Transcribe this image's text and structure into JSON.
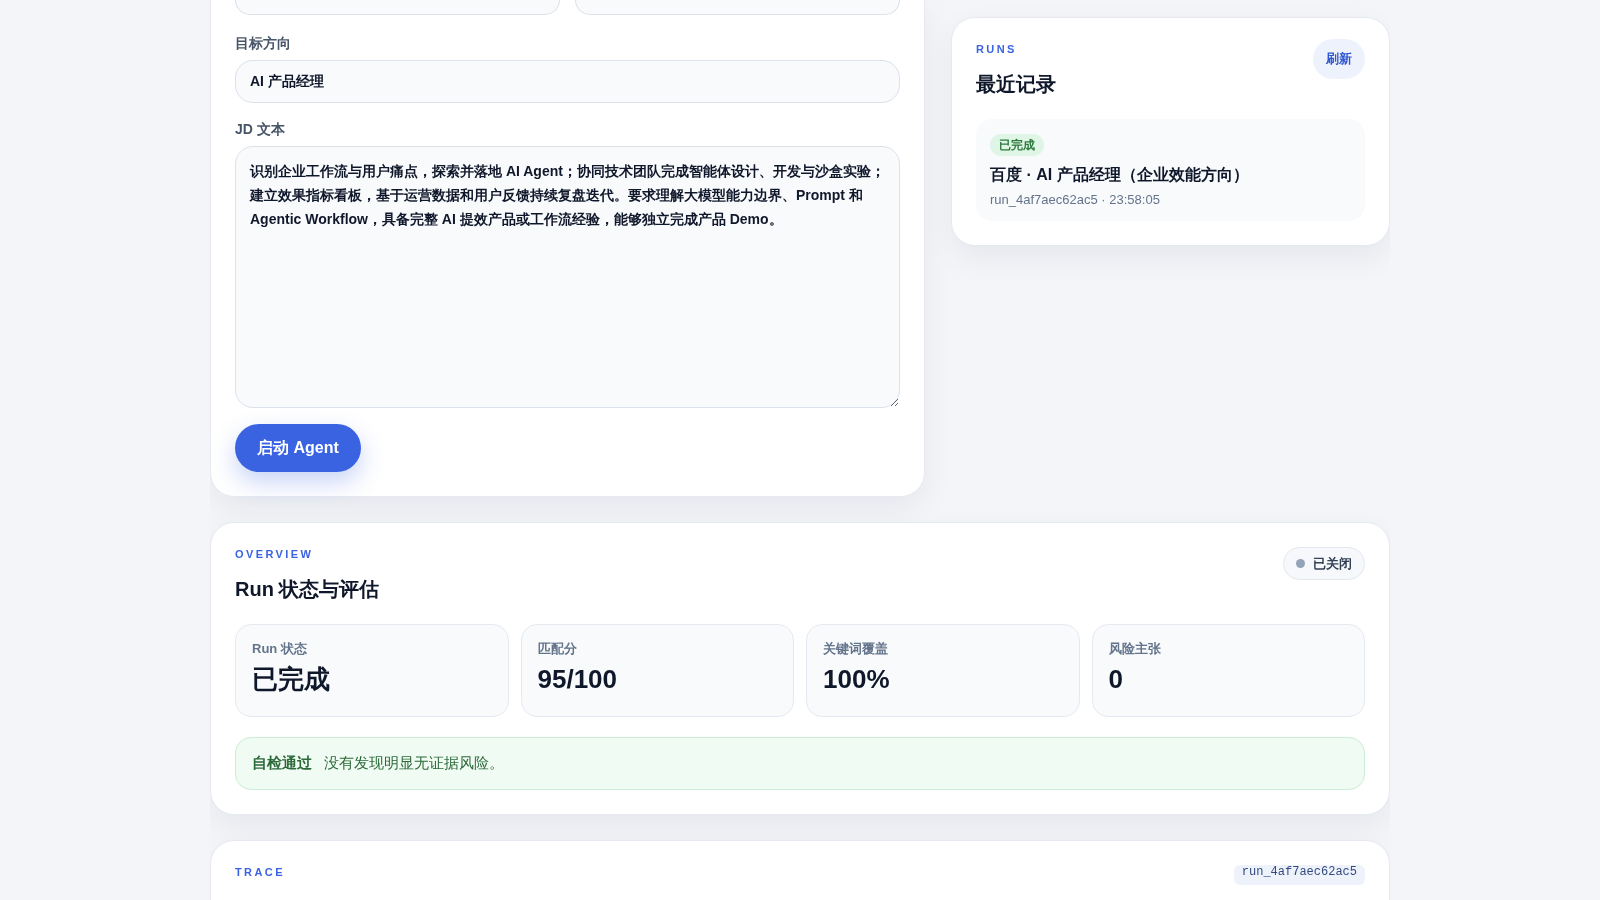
{
  "form": {
    "top_fields": [
      {
        "kind": "input"
      },
      {
        "kind": "input"
      }
    ],
    "fields": [
      {
        "label": "目标方向",
        "kind": "input",
        "value": "AI 产品经理"
      },
      {
        "label": "JD 文本",
        "kind": "textarea",
        "value": "识别企业工作流与用户痛点，探索并落地 AI Agent；协同技术团队完成智能体设计、开发与沙盒实验；建立效果指标看板，基于运营数据和用户反馈持续复盘迭代。要求理解大模型能力边界、Prompt 和 Agentic Workflow，具备完整 AI 提效产品或工作流经验，能够独立完成产品 Demo。"
      }
    ],
    "submit_button": "启动 Agent"
  },
  "runs": {
    "eyebrow": "RUNS",
    "title": "最近记录",
    "refresh_button": "刷新",
    "items": [
      {
        "status": "已完成",
        "completed": true,
        "title": "百度 · AI 产品经理（企业效能方向）",
        "meta": "run_4af7aec62ac5 · 23:58:05"
      }
    ]
  },
  "overview": {
    "eyebrow": "OVERVIEW",
    "title": "Run 状态与评估",
    "connection": {
      "label": "已关闭",
      "connected": false
    },
    "metrics": [
      {
        "label": "Run 状态",
        "value": "已完成"
      },
      {
        "label": "匹配分",
        "value": "95/100"
      },
      {
        "label": "关键词覆盖",
        "value": "100%"
      },
      {
        "label": "风险主张",
        "value": "0"
      }
    ],
    "check": {
      "title": "自检通过",
      "message": "没有发现明显无证据风险。",
      "passed": true
    }
  },
  "trace": {
    "eyebrow": "TRACE",
    "run_id": "run_4af7aec62ac5"
  }
}
